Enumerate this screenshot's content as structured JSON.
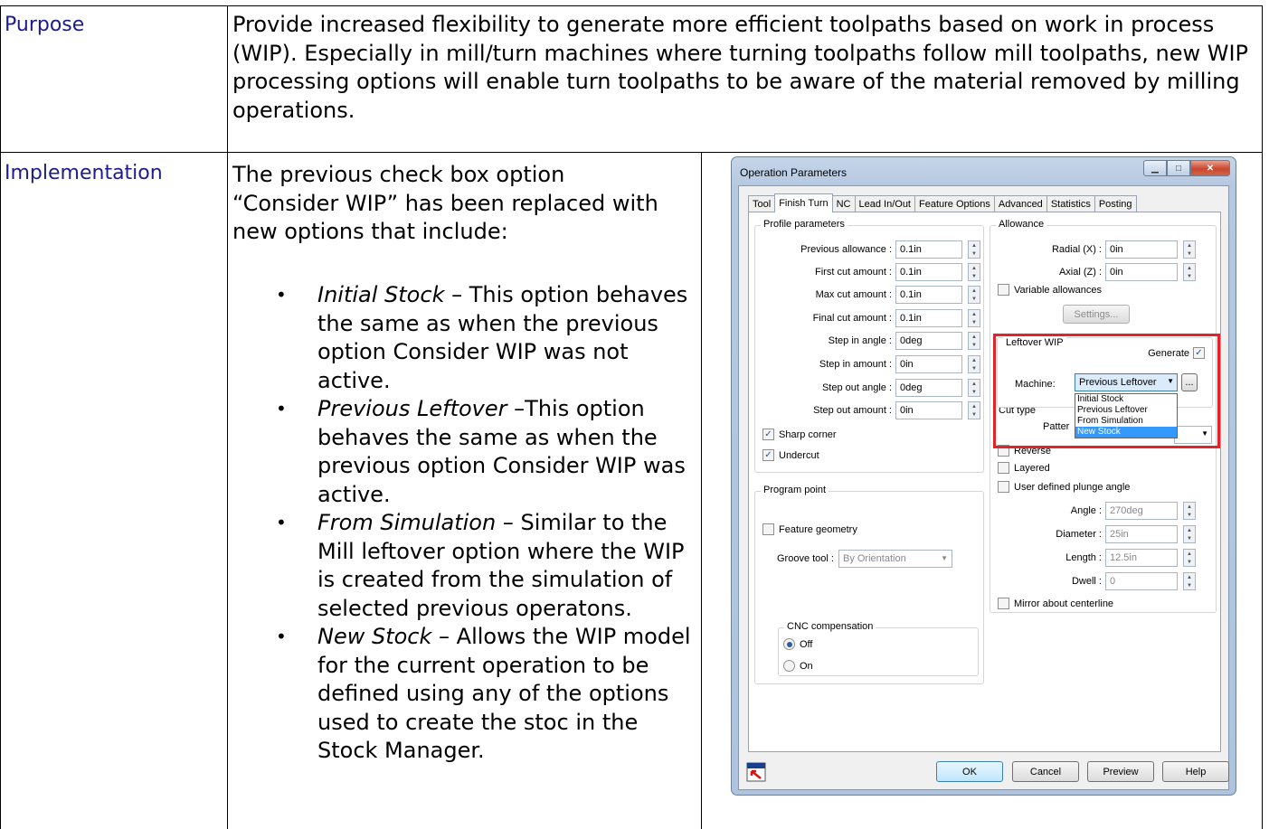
{
  "table": {
    "purpose_label": "Purpose",
    "purpose_text": "Provide increased flexibility to generate more efficient toolpaths based on work in process (WIP).  Especially in mill/turn machines where turning toolpaths follow mill toolpaths, new WIP processing options will enable turn toolpaths to be aware of the material removed by milling operations.",
    "implementation_label": "Implementation",
    "implementation_intro": "The previous check box option “Consider WIP” has been replaced with new options that include:",
    "bullets": [
      {
        "term": "Initial Stock",
        "text": " – This option behaves the same as when the previous option Consider WIP was not active."
      },
      {
        "term": "Previous Leftover",
        "text": " –This option behaves the same as when the previous option Consider WIP was active."
      },
      {
        "term": "From Simulation",
        "text": " – Similar to the Mill leftover option where the WIP is created from the simulation of selected previous operatons."
      },
      {
        "term": "New Stock",
        "text": " – Allows the WIP model for the current operation to be defined using any of the options used to create the stoc in the Stock Manager."
      }
    ]
  },
  "dialog": {
    "title": "Operation Parameters",
    "tabs": [
      "Tool",
      "Finish Turn",
      "NC",
      "Lead In/Out",
      "Feature Options",
      "Advanced",
      "Statistics",
      "Posting"
    ],
    "active_tab": "Finish Turn",
    "profile": {
      "title": "Profile parameters",
      "rows": [
        {
          "label": "Previous allowance :",
          "value": "0.1in"
        },
        {
          "label": "First cut amount :",
          "value": "0.1in"
        },
        {
          "label": "Max cut amount :",
          "value": "0.1in"
        },
        {
          "label": "Final cut amount :",
          "value": "0.1in"
        },
        {
          "label": "Step in angle :",
          "value": "0deg"
        },
        {
          "label": "Step in amount :",
          "value": "0in"
        },
        {
          "label": "Step out angle :",
          "value": "0deg"
        },
        {
          "label": "Step out amount :",
          "value": "0in"
        }
      ],
      "sharp_corner": "Sharp corner",
      "undercut": "Undercut"
    },
    "program_point": {
      "title": "Program point",
      "feature_geometry": "Feature geometry",
      "groove_tool_label": "Groove tool :",
      "groove_tool_value": "By Orientation",
      "cnc_title": "CNC compensation",
      "off": "Off",
      "on": "On"
    },
    "allowance": {
      "title": "Allowance",
      "radial_label": "Radial (X) :",
      "radial_value": "0in",
      "axial_label": "Axial (Z) :",
      "axial_value": "0in",
      "variable": "Variable allowances",
      "settings": "Settings..."
    },
    "leftover": {
      "title": "Leftover WIP",
      "generate": "Generate",
      "machine_label": "Machine:",
      "machine_value": "Previous Leftover",
      "browse": "...",
      "options": [
        "Initial Stock",
        "Previous Leftover",
        "From Simulation",
        "New Stock"
      ],
      "selected_option": "New Stock"
    },
    "cut_type": {
      "title": "Cut type",
      "pattern_label": "Patter",
      "reverse": "Reverse",
      "layered": "Layered",
      "user_plunge": "User defined plunge angle",
      "angle_label": "Angle :",
      "angle_value": "270deg",
      "diameter_label": "Diameter :",
      "diameter_value": "25in",
      "length_label": "Length :",
      "length_value": "12.5in",
      "dwell_label": "Dwell :",
      "dwell_value": "0",
      "mirror": "Mirror about centerline"
    },
    "buttons": {
      "ok": "OK",
      "cancel": "Cancel",
      "preview": "Preview",
      "help": "Help"
    },
    "colors": {
      "highlight": "#e0242a",
      "selection": "#3399ff"
    }
  }
}
